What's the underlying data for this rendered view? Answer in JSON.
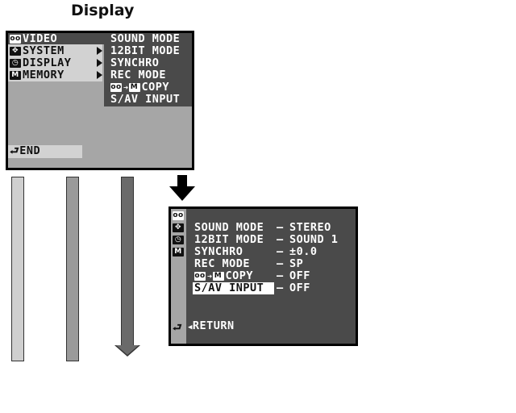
{
  "heading": "Display",
  "screen1": {
    "main_menu": [
      {
        "icon": "tape-icon",
        "label": "VIDEO"
      },
      {
        "icon": "system-icon",
        "label": "SYSTEM"
      },
      {
        "icon": "display-icon",
        "label": "DISPLAY"
      },
      {
        "icon": "memory-icon",
        "label": "MEMORY"
      }
    ],
    "sub_menu": [
      "SOUND MODE",
      "12BIT MODE",
      "SYNCHRO",
      "REC MODE",
      "COPY",
      "S/AV INPUT"
    ],
    "end_label": "END"
  },
  "screen2": {
    "settings": [
      {
        "label": "SOUND MODE",
        "value": "STEREO"
      },
      {
        "label": "12BIT MODE",
        "value": "SOUND 1"
      },
      {
        "label": "SYNCHRO",
        "value": "±0.0"
      },
      {
        "label": "REC MODE",
        "value": "SP"
      },
      {
        "label": "COPY",
        "value": "OFF"
      },
      {
        "label": "S/AV INPUT",
        "value": "OFF"
      }
    ],
    "dash": "–",
    "return_label": "RETURN"
  },
  "colors": {
    "lcd_gray": "#a6a6a6",
    "menu_dark": "#4a4a4a",
    "highlight": "#d2d2d2"
  }
}
